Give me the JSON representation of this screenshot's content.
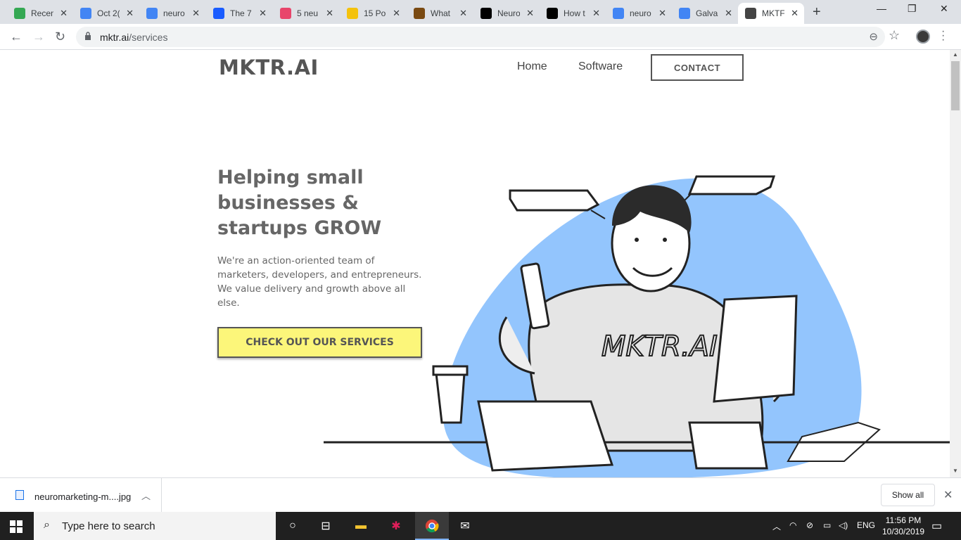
{
  "browser": {
    "tabs": [
      {
        "title": "Recen",
        "icon": "google-drive-icon",
        "color": "#34a853"
      },
      {
        "title": "Oct 2(",
        "icon": "google-docs-icon",
        "color": "#4285f4"
      },
      {
        "title": "neuro",
        "icon": "google-icon",
        "color": "#4285f4"
      },
      {
        "title": "The 7",
        "icon": "blue-square-icon",
        "color": "#1a5cff"
      },
      {
        "title": "5 neu",
        "icon": "pink-circle-icon",
        "color": "#e8456b"
      },
      {
        "title": "15 Po",
        "icon": "yellow-ring-icon",
        "color": "#f4c20d"
      },
      {
        "title": "What",
        "icon": "brown-circle-icon",
        "color": "#7a4a12"
      },
      {
        "title": "Neuro",
        "icon": "neuro-logo-icon",
        "color": "#000000"
      },
      {
        "title": "How t",
        "icon": "uae-logo-icon",
        "color": "#000000"
      },
      {
        "title": "neuro",
        "icon": "google-icon",
        "color": "#4285f4"
      },
      {
        "title": "Galva",
        "icon": "google-icon",
        "color": "#4285f4"
      },
      {
        "title": "MKTF",
        "icon": "mktr-icon",
        "color": "#444444"
      }
    ],
    "url_host": "mktr.ai",
    "url_path": "/services"
  },
  "site": {
    "logo": "MKTR.AI",
    "nav": {
      "home": "Home",
      "software": "Software",
      "contact": "CONTACT"
    },
    "hero": {
      "headline": "Helping small businesses & startups GROW",
      "tagline": "We're an action-oriented team of marketers, developers, and entrepreneurs. We value delivery and growth above all else.",
      "cta": "CHECK OUT OUR SERVICES",
      "sweatshirt_text": "MKTR.AI"
    },
    "colors": {
      "blob": "#93c5fd",
      "cta_bg": "#fcf67a",
      "text": "#666666"
    }
  },
  "downloads": {
    "file": "neuromarketing-m....jpg",
    "show_all": "Show all"
  },
  "taskbar": {
    "search_placeholder": "Type here to search",
    "language": "ENG",
    "time": "11:56 PM",
    "date": "10/30/2019"
  }
}
